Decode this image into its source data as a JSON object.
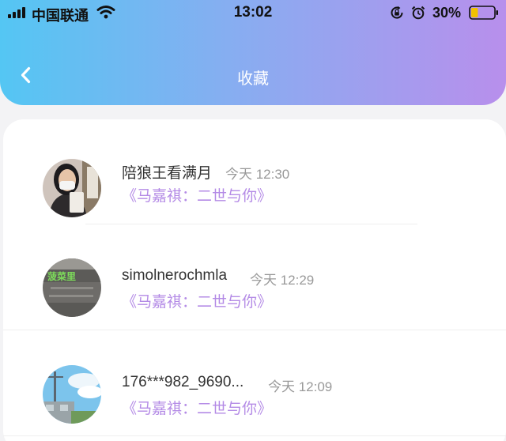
{
  "status_bar": {
    "carrier": "中国联通",
    "time": "13:02",
    "battery_percent": "30%",
    "battery_level": 0.3,
    "icons": [
      "signal-icon",
      "wifi-icon",
      "rotation-lock-icon",
      "alarm-icon",
      "battery-icon"
    ]
  },
  "nav": {
    "title": "收藏",
    "back_icon": "chevron-left-icon"
  },
  "favorites": [
    {
      "username": "陪狼王看满月",
      "time": "今天 12:30",
      "work": "《马嘉祺：二世与你》"
    },
    {
      "username": "simolnerochmla",
      "time": "今天 12:29",
      "work": "《马嘉祺：二世与你》"
    },
    {
      "username": "176***982_9690...",
      "time": "今天 12:09",
      "work": "《马嘉祺：二世与你》"
    }
  ],
  "colors": {
    "header_gradient_start": "#54c6f3",
    "header_gradient_end": "#b88fec",
    "work_title": "#b48be6",
    "username": "#333333",
    "time": "#999999"
  }
}
